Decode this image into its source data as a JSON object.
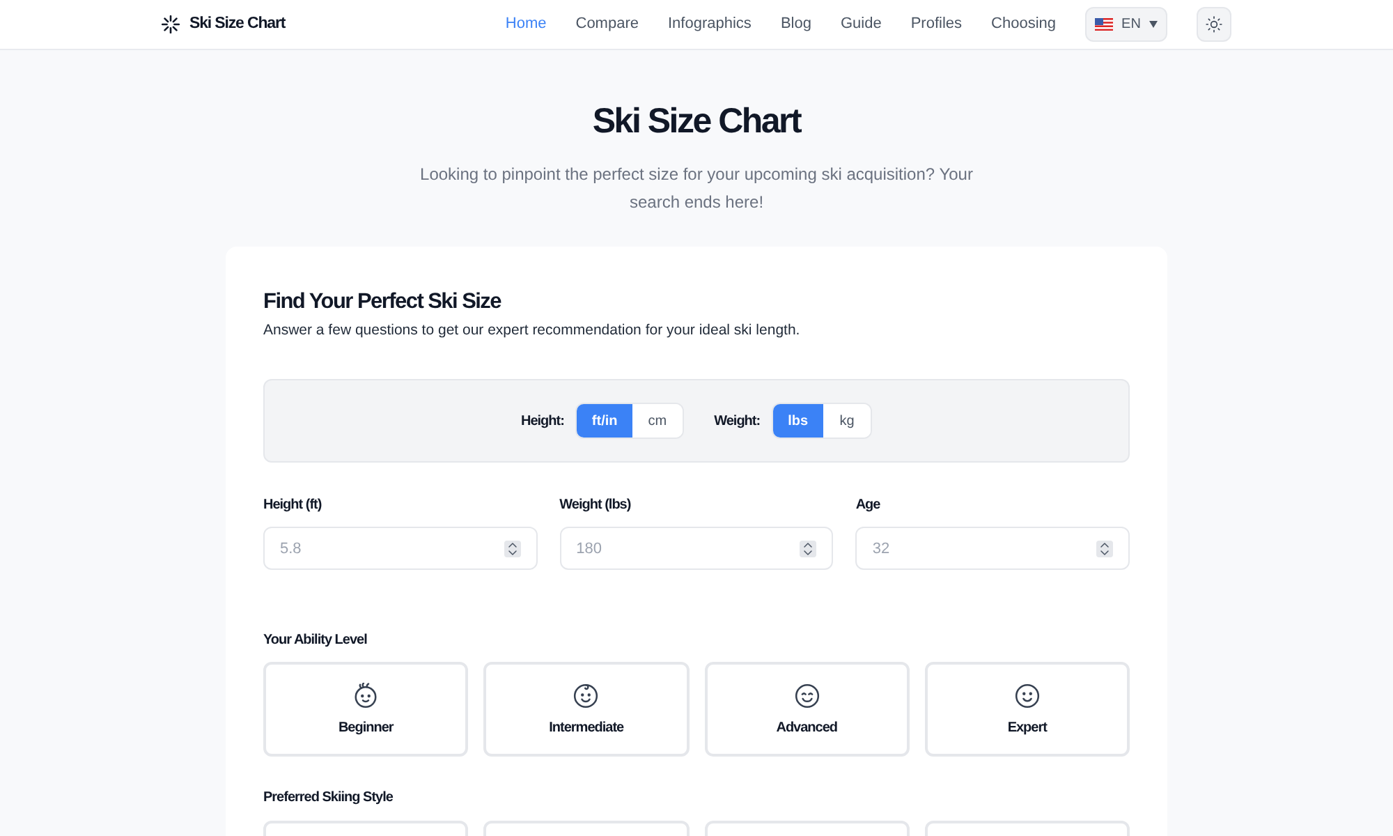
{
  "header": {
    "logo_text": "Ski Size Chart",
    "nav": [
      {
        "label": "Home",
        "selected": true
      },
      {
        "label": "Compare",
        "selected": false
      },
      {
        "label": "Infographics",
        "selected": false
      },
      {
        "label": "Blog",
        "selected": false
      },
      {
        "label": "Guide",
        "selected": false
      },
      {
        "label": "Profiles",
        "selected": false
      },
      {
        "label": "Choosing",
        "selected": false
      }
    ],
    "language": {
      "label": "EN"
    }
  },
  "hero": {
    "title": "Ski Size Chart",
    "subtitle": "Looking to pinpoint the perfect size for your upcoming ski acquisition? Your search ends here!"
  },
  "finder": {
    "title": "Find Your Perfect Ski Size",
    "description": "Answer a few questions to get our expert recommendation for your ideal ski length.",
    "units": [
      {
        "label": "Height:",
        "options": [
          {
            "label": "ft/in",
            "selected": true
          },
          {
            "label": "cm",
            "selected": false
          }
        ]
      },
      {
        "label": "Weight:",
        "options": [
          {
            "label": "lbs",
            "selected": true
          },
          {
            "label": "kg",
            "selected": false
          }
        ]
      }
    ],
    "fields": [
      {
        "label": "Height (ft)",
        "placeholder": "5.8"
      },
      {
        "label": "Weight (lbs)",
        "placeholder": "180"
      },
      {
        "label": "Age",
        "placeholder": "32"
      }
    ],
    "ability": {
      "label": "Your Ability Level",
      "options": [
        {
          "label": "Beginner",
          "kind": "baby",
          "selected": false
        },
        {
          "label": "Intermediate",
          "kind": "curl",
          "selected": false
        },
        {
          "label": "Advanced",
          "kind": "grin",
          "selected": false
        },
        {
          "label": "Expert",
          "kind": "smile",
          "selected": false
        }
      ]
    },
    "style": {
      "label": "Preferred Skiing Style"
    }
  }
}
